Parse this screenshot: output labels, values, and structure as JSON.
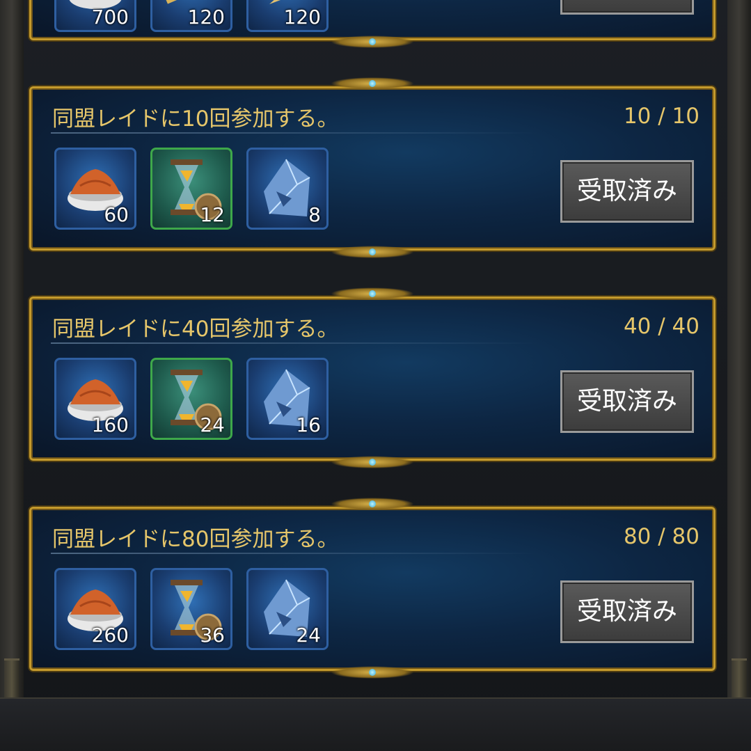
{
  "top_card": {
    "rewards": [
      {
        "icon": "spice-bowl-icon",
        "qty": "700"
      },
      {
        "icon": "grain-icon",
        "qty": "120"
      },
      {
        "icon": "arrow-item-icon",
        "qty": "120"
      }
    ]
  },
  "quests": [
    {
      "title": "同盟レイドに10回参加する。",
      "progress": "10 / 10",
      "button": "受取済み",
      "rewards": [
        {
          "icon": "spice-bowl-icon",
          "qty": "60"
        },
        {
          "icon": "hourglass-speedup-icon",
          "qty": "12",
          "frame": "green"
        },
        {
          "icon": "crystal-icon",
          "qty": "8"
        }
      ]
    },
    {
      "title": "同盟レイドに40回参加する。",
      "progress": "40 / 40",
      "button": "受取済み",
      "rewards": [
        {
          "icon": "spice-bowl-icon",
          "qty": "160"
        },
        {
          "icon": "hourglass-speedup-icon",
          "qty": "24",
          "frame": "green"
        },
        {
          "icon": "crystal-icon",
          "qty": "16"
        }
      ]
    },
    {
      "title": "同盟レイドに80回参加する。",
      "progress": "80 / 80",
      "button": "受取済み",
      "rewards": [
        {
          "icon": "spice-bowl-icon",
          "qty": "260"
        },
        {
          "icon": "hourglass-speedup-icon",
          "qty": "36",
          "frame": "blue"
        },
        {
          "icon": "crystal-icon",
          "qty": "24"
        }
      ]
    }
  ],
  "colors": {
    "gold": "#c49a2c",
    "text_gold": "#e6c66a",
    "panel_blue": "#0d2643"
  }
}
